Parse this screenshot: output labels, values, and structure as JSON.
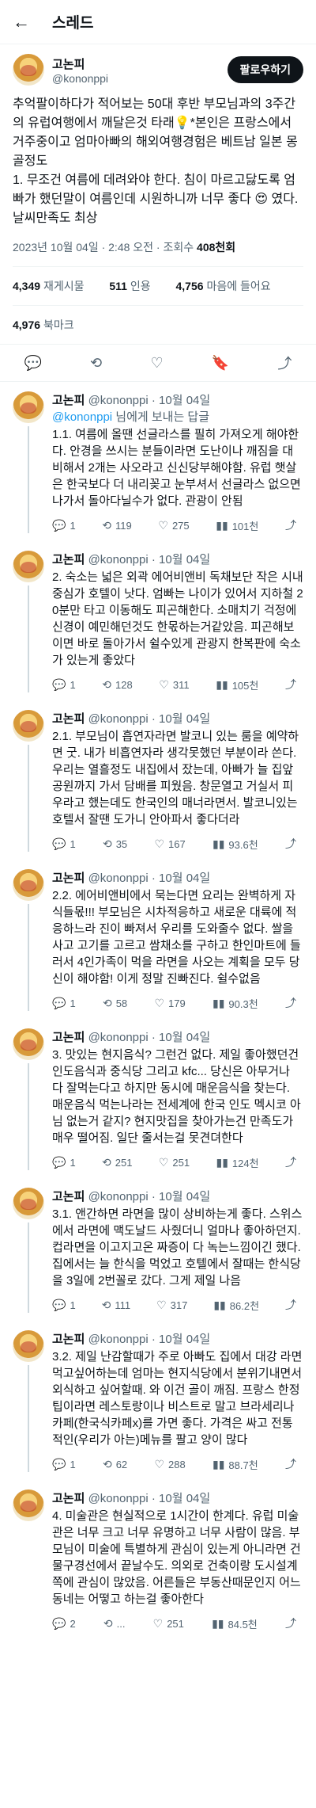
{
  "header": {
    "back_icon": "←",
    "title": "스레드"
  },
  "author": {
    "name": "고논피",
    "handle": "@kononppi",
    "follow_label": "팔로우하기"
  },
  "main_tweet": {
    "text": "추억팔이하다가 적어보는 50대 후반 부모님과의 3주간의 유럽여행에서 깨달은것 타래💡*본인은 프랑스에서 거주중이고 엄마아빠의 해외여행경험은 베트남 일본 몽골정도\n1. 무조건 여름에 데려와야 한다. 침이 마르고닳도록 엄빠가 했던말이 여름인데 시원하니까 너무 좋다 😍 였다. 날씨만족도 최상",
    "time": "2023년 10월 04일 · 2:48 오전 · 조회수",
    "views": "408천회"
  },
  "stats": {
    "retweets": "4,349",
    "retweets_label": "재게시물",
    "quotes": "511",
    "quotes_label": "인용",
    "likes": "4,756",
    "likes_label": "마음에 들어요",
    "bookmarks": "4,976",
    "bookmarks_label": "북마크"
  },
  "action_icons": {
    "reply": "💬",
    "retweet": "⟲",
    "like": "♡",
    "bookmark": "🔖",
    "share": "⤴"
  },
  "replies": [
    {
      "name": "고논피",
      "handle": "@kononppi",
      "date": "· 10월 04일",
      "replying_to": "@kononppi",
      "replying_suffix": " 님에게 보내는 답글",
      "text": "1.1. 여름에 올땐 선글라스를 필히 가져오게 해야한다. 안경을 쓰시는 분들이라면 도난이나 깨짐을 대비해서 2개는 사오라고 신신당부해야함. 유럽 햇살은 한국보다 더 내리꽂고 눈부셔서 선글라스 없으면 나가서 돌아다닐수가 없다. 관광이 안됨",
      "replies": "1",
      "retweets": "119",
      "likes": "275",
      "views": "101천"
    },
    {
      "name": "고논피",
      "handle": "@kononppi",
      "date": "· 10월 04일",
      "text": "2. 숙소는 넓은 외곽 에어비앤비 독채보단 작은 시내중심가 호텔이 낫다. 엄빠는 나이가 있어서 지하철 20분만 타고 이동해도 피곤해한다. 소매치기 걱정에 신경이 예민해던것도 한몫하는거같았음. 피곤해보이면 바로 돌아가서 쉴수있게 관광지 한복판에 숙소가 있는게 좋았다",
      "replies": "1",
      "retweets": "128",
      "likes": "311",
      "views": "105천"
    },
    {
      "name": "고논피",
      "handle": "@kononppi",
      "date": "· 10월 04일",
      "text": "2.1. 부모님이 흡연자라면 발코니 있는 룸을 예약하면 굿. 내가 비흡연자라 생각못했던 부분이라 쓴다. 우리는 열흘정도 내집에서 잤는데, 아빠가 늘 집앞공원까지 가서 담배를 피웠음. 창문열고 거실서 피우라고 했는데도 한국인의 매너라면서. 발코니있는 호텔서 잘땐 도가니 안아파서 좋다더라",
      "replies": "1",
      "retweets": "35",
      "likes": "167",
      "views": "93.6천"
    },
    {
      "name": "고논피",
      "handle": "@kononppi",
      "date": "· 10월 04일",
      "text": "2.2. 에어비앤비에서 묵는다면 요리는 완벽하게 자식들몫!!! 부모님은 시차적응하고 새로운 대륙에 적응하느라 진이 빠져서 우리를 도와줄수 없다. 쌀을 사고 고기를 고르고 쌈채소를 구하고 한인마트에 들러서 4인가족이 먹을 라면을 사오는 계획을 모두 당신이 해야함! 이게 정말 진빠진다. 쉴수없음",
      "replies": "1",
      "retweets": "58",
      "likes": "179",
      "views": "90.3천"
    },
    {
      "name": "고논피",
      "handle": "@kononppi",
      "date": "· 10월 04일",
      "text": "3. 맛있는 현지음식? 그런건 없다. 제일 좋아했던건 인도음식과 중식당 그리고 kfc... 당신은 아무거나 다 잘먹는다고 하지만 동시에 매운음식을 찾는다. 매운음식 먹는나라는 전세계에 한국 인도 멕시코 아님 없는거 같지? 현지맛집을 찾아가는건 만족도가 매우 떨어짐. 일단 줄서는걸 못견뎌한다",
      "replies": "1",
      "retweets": "251",
      "likes": "251",
      "views": "124천"
    },
    {
      "name": "고논피",
      "handle": "@kononppi",
      "date": "· 10월 04일",
      "text": "3.1. 앤간하면 라면을 많이 상비하는게 좋다. 스위스에서 라면에 맥도날드 사줬더니 얼마나 좋아하던지. 컵라면을 이고지고온 짜증이 다 녹는느낌이긴 했다. 집에서는 늘 한식을 먹었고 호텔에서 잘때는 한식당을 3일에 2번꼴로 갔다. 그게 제일 나음",
      "replies": "1",
      "retweets": "111",
      "likes": "317",
      "views": "86.2천"
    },
    {
      "name": "고논피",
      "handle": "@kononppi",
      "date": "· 10월 04일",
      "text": "3.2. 제일 난감할때가 주로 아빠도 집에서 대강 라면먹고싶어하는데 엄마는 현지식당에서 분위기내면서 외식하고 싶어할때. 와 이건 골이 깨짐. 프랑스 한정 팁이라면 레스토랑이나 비스트로 말고 브라세리나 카페(한국식카페x)를 가면 좋다. 가격은 싸고 전통적인(우리가 아는)메뉴를 팔고 양이 많다",
      "replies": "1",
      "retweets": "62",
      "likes": "288",
      "views": "88.7천"
    },
    {
      "name": "고논피",
      "handle": "@kononppi",
      "date": "· 10월 04일",
      "text": "4. 미술관은 현실적으로 1시간이 한계다. 유럽 미술관은 너무 크고 너무 유명하고 너무 사람이 많음. 부모님이 미술에 특별하게 관심이 있는게 아니라면 건물구경선에서 끝날수도. 의외로 건축이랑 도시설계쪽에 관심이 많았음. 어른들은 부동산때문인지 어느동네는 어떻고 하는걸 좋아한다",
      "replies": "2",
      "retweets": "...",
      "likes": "251",
      "views": "84.5천"
    }
  ]
}
